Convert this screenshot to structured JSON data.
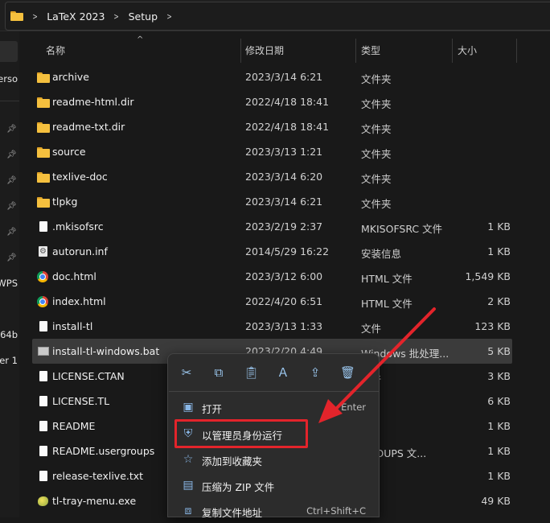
{
  "address": {
    "crumbs": [
      "LaTeX 2023",
      "Setup"
    ]
  },
  "nav": {
    "fragments": [
      "erso",
      "WPS",
      "64b",
      "er 1"
    ]
  },
  "columns": {
    "name": "名称",
    "date": "修改日期",
    "type": "类型",
    "size": "大小"
  },
  "files": [
    {
      "name": "archive",
      "date": "2023/3/14 6:21",
      "type": "文件夹",
      "size": "",
      "icon": "folder-icon"
    },
    {
      "name": "readme-html.dir",
      "date": "2022/4/18 18:41",
      "type": "文件夹",
      "size": "",
      "icon": "folder-icon"
    },
    {
      "name": "readme-txt.dir",
      "date": "2022/4/18 18:41",
      "type": "文件夹",
      "size": "",
      "icon": "folder-icon"
    },
    {
      "name": "source",
      "date": "2023/3/13 1:21",
      "type": "文件夹",
      "size": "",
      "icon": "folder-icon"
    },
    {
      "name": "texlive-doc",
      "date": "2023/3/14 6:20",
      "type": "文件夹",
      "size": "",
      "icon": "folder-icon"
    },
    {
      "name": "tlpkg",
      "date": "2023/3/14 6:21",
      "type": "文件夹",
      "size": "",
      "icon": "folder-icon"
    },
    {
      "name": ".mkisofsrc",
      "date": "2023/2/19 2:37",
      "type": "MKISOFSRC 文件",
      "size": "1 KB",
      "icon": "file-icon"
    },
    {
      "name": "autorun.inf",
      "date": "2014/5/29 16:22",
      "type": "安装信息",
      "size": "1 KB",
      "icon": "settings-file-icon"
    },
    {
      "name": "doc.html",
      "date": "2023/3/12 6:00",
      "type": "HTML 文件",
      "size": "1,549 KB",
      "icon": "chrome-icon"
    },
    {
      "name": "index.html",
      "date": "2022/4/20 6:51",
      "type": "HTML 文件",
      "size": "2 KB",
      "icon": "chrome-icon"
    },
    {
      "name": "install-tl",
      "date": "2023/3/13 1:33",
      "type": "文件",
      "size": "123 KB",
      "icon": "file-icon"
    },
    {
      "name": "install-tl-windows.bat",
      "date": "2023/2/20 4:49",
      "type": "Windows 批处理...",
      "size": "5 KB",
      "icon": "batch-file-icon",
      "selected": true
    },
    {
      "name": "LICENSE.CTAN",
      "date": "",
      "type": "文件",
      "size": "3 KB",
      "icon": "file-icon"
    },
    {
      "name": "LICENSE.TL",
      "date": "",
      "type": "件",
      "size": "6 KB",
      "icon": "file-icon"
    },
    {
      "name": "README",
      "date": "",
      "type": "",
      "size": "1 KB",
      "icon": "file-icon"
    },
    {
      "name": "README.usergroups",
      "date": "",
      "type": "GROUPS 文...",
      "size": "1 KB",
      "icon": "file-icon"
    },
    {
      "name": "release-texlive.txt",
      "date": "",
      "type": "档",
      "size": "1 KB",
      "icon": "file-icon"
    },
    {
      "name": "tl-tray-menu.exe",
      "date": "",
      "type": "序",
      "size": "49 KB",
      "icon": "exe-icon"
    }
  ],
  "context_menu": {
    "quick_actions": [
      "cut-icon",
      "copy-icon",
      "paste-icon",
      "rename-icon",
      "share-icon",
      "delete-icon"
    ],
    "items": [
      {
        "label": "打开",
        "shortcut": "Enter",
        "icon": "open-icon"
      },
      {
        "label": "以管理员身份运行",
        "shortcut": "",
        "icon": "admin-shield-icon"
      },
      {
        "label": "添加到收藏夹",
        "shortcut": "",
        "icon": "star-icon"
      },
      {
        "label": "压缩为 ZIP 文件",
        "shortcut": "",
        "icon": "zip-icon"
      },
      {
        "label": "复制文件地址",
        "shortcut": "Ctrl+Shift+C",
        "icon": "copy-path-icon"
      }
    ]
  },
  "annotation": {
    "highlight_color": "#e3242b",
    "arrow_color": "#e3242b"
  }
}
